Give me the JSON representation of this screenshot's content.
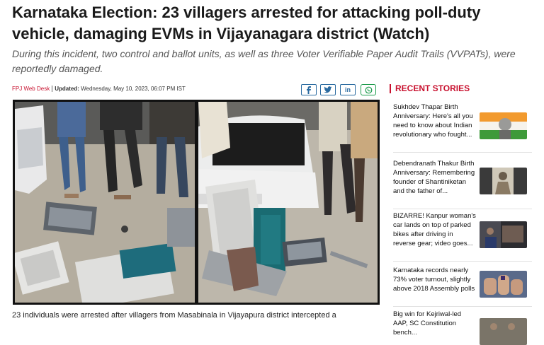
{
  "article": {
    "headline": "Karnataka Election: 23 villagers arrested for attacking poll-duty vehicle, damaging EVMs in Vijayanagara district (Watch)",
    "subheadline": "During this incident, two control and ballot units, as well as three Voter Verifiable Paper Audit Trails (VVPATs), were reportedly damaged.",
    "author": "FPJ Web Desk",
    "updated_label": "Updated:",
    "updated_date": "Wednesday, May 10, 2023, 06:07 PM IST",
    "body_start": "23 individuals were arrested after villagers from Masabinala in Vijayapura district intercepted a"
  },
  "share": {
    "facebook": "facebook-icon",
    "twitter": "twitter-icon",
    "linkedin": "linkedin-icon",
    "linkedin_text": "in",
    "whatsapp": "whatsapp-icon"
  },
  "sidebar": {
    "heading": "RECENT STORIES",
    "stories": [
      {
        "title": "Sukhdev Thapar Birth Anniversary: Here's all you need to know about Indian revolutionary who fought...",
        "thumb": "portrait-tricolor"
      },
      {
        "title": "Debendranath Thakur Birth Anniversary: Remembering founder of Shantiniketan and the father of...",
        "thumb": "portrait-sepia"
      },
      {
        "title": "BIZARRE! Kanpur woman's car lands on top of parked bikes after driving in reverse gear; video goes...",
        "thumb": "street-photo"
      },
      {
        "title": "Karnataka records nearly 73% voter turnout, slightly above 2018 Assembly polls",
        "thumb": "inked-finger"
      },
      {
        "title": "Big win for Kejriwal-led AAP, SC Constitution bench...",
        "thumb": "meeting"
      }
    ]
  },
  "colors": {
    "accent": "#c8102e",
    "share_blue": "#2a6aa0",
    "whatsapp_green": "#1a9a4a"
  }
}
